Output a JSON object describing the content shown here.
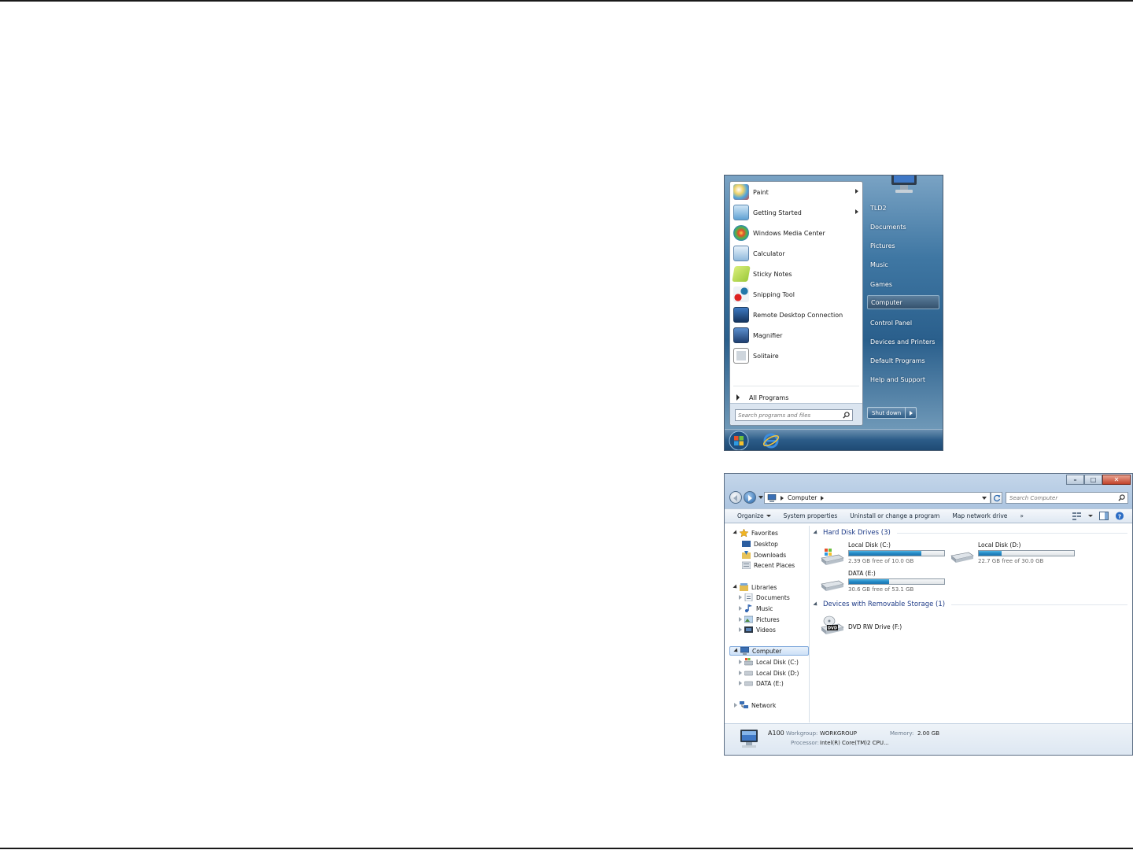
{
  "start_menu": {
    "programs": [
      {
        "label": "Paint",
        "has_submenu": true,
        "icon": "paint-icon"
      },
      {
        "label": "Getting Started",
        "has_submenu": true,
        "icon": "getting-started-icon"
      },
      {
        "label": "Windows Media Center",
        "has_submenu": false,
        "icon": "media-center-icon"
      },
      {
        "label": "Calculator",
        "has_submenu": false,
        "icon": "calculator-icon"
      },
      {
        "label": "Sticky Notes",
        "has_submenu": false,
        "icon": "sticky-notes-icon"
      },
      {
        "label": "Snipping Tool",
        "has_submenu": false,
        "icon": "snipping-tool-icon"
      },
      {
        "label": "Remote Desktop Connection",
        "has_submenu": false,
        "icon": "remote-desktop-icon"
      },
      {
        "label": "Magnifier",
        "has_submenu": false,
        "icon": "magnifier-icon"
      },
      {
        "label": "Solitaire",
        "has_submenu": false,
        "icon": "solitaire-icon"
      }
    ],
    "all_programs": "All Programs",
    "search_placeholder": "Search programs and files",
    "right_links": [
      "TLD2",
      "Documents",
      "Pictures",
      "Music",
      "Games",
      "Computer",
      "Control Panel",
      "Devices and Printers",
      "Default Programs",
      "Help and Support"
    ],
    "selected_link": "Computer",
    "shutdown_label": "Shut down"
  },
  "explorer": {
    "address": {
      "crumb": "Computer"
    },
    "search_placeholder": "Search Computer",
    "toolbar": {
      "organize": "Organize",
      "system_properties": "System properties",
      "uninstall": "Uninstall or change a program",
      "map_drive": "Map network drive",
      "more": "»"
    },
    "nav": {
      "favorites": "Favorites",
      "desktop": "Desktop",
      "downloads": "Downloads",
      "recent": "Recent Places",
      "libraries": "Libraries",
      "documents": "Documents",
      "music": "Music",
      "pictures": "Pictures",
      "videos": "Videos",
      "computer": "Computer",
      "disk_c": "Local Disk (C:)",
      "disk_d": "Local Disk (D:)",
      "disk_e": "DATA (E:)",
      "network": "Network"
    },
    "hard_drives_header": "Hard Disk Drives (3)",
    "drives": [
      {
        "name": "Local Disk (C:)",
        "free": "2.39 GB free of 10.0 GB",
        "used_fraction": 0.76
      },
      {
        "name": "Local Disk (D:)",
        "free": "22.7 GB free of 30.0 GB",
        "used_fraction": 0.24
      },
      {
        "name": "DATA (E:)",
        "free": "30.6 GB free of 53.1 GB",
        "used_fraction": 0.42
      }
    ],
    "removable_header": "Devices with Removable Storage (1)",
    "dvd": {
      "name": "DVD RW Drive (F:)",
      "badge": "DVD"
    },
    "details": {
      "name": "A100",
      "workgroup_label": "Workgroup:",
      "workgroup": "WORKGROUP",
      "memory_label": "Memory:",
      "memory": "2.00 GB",
      "processor_label": "Processor:",
      "processor": "Intel(R) Core(TM)2 CPU..."
    }
  }
}
